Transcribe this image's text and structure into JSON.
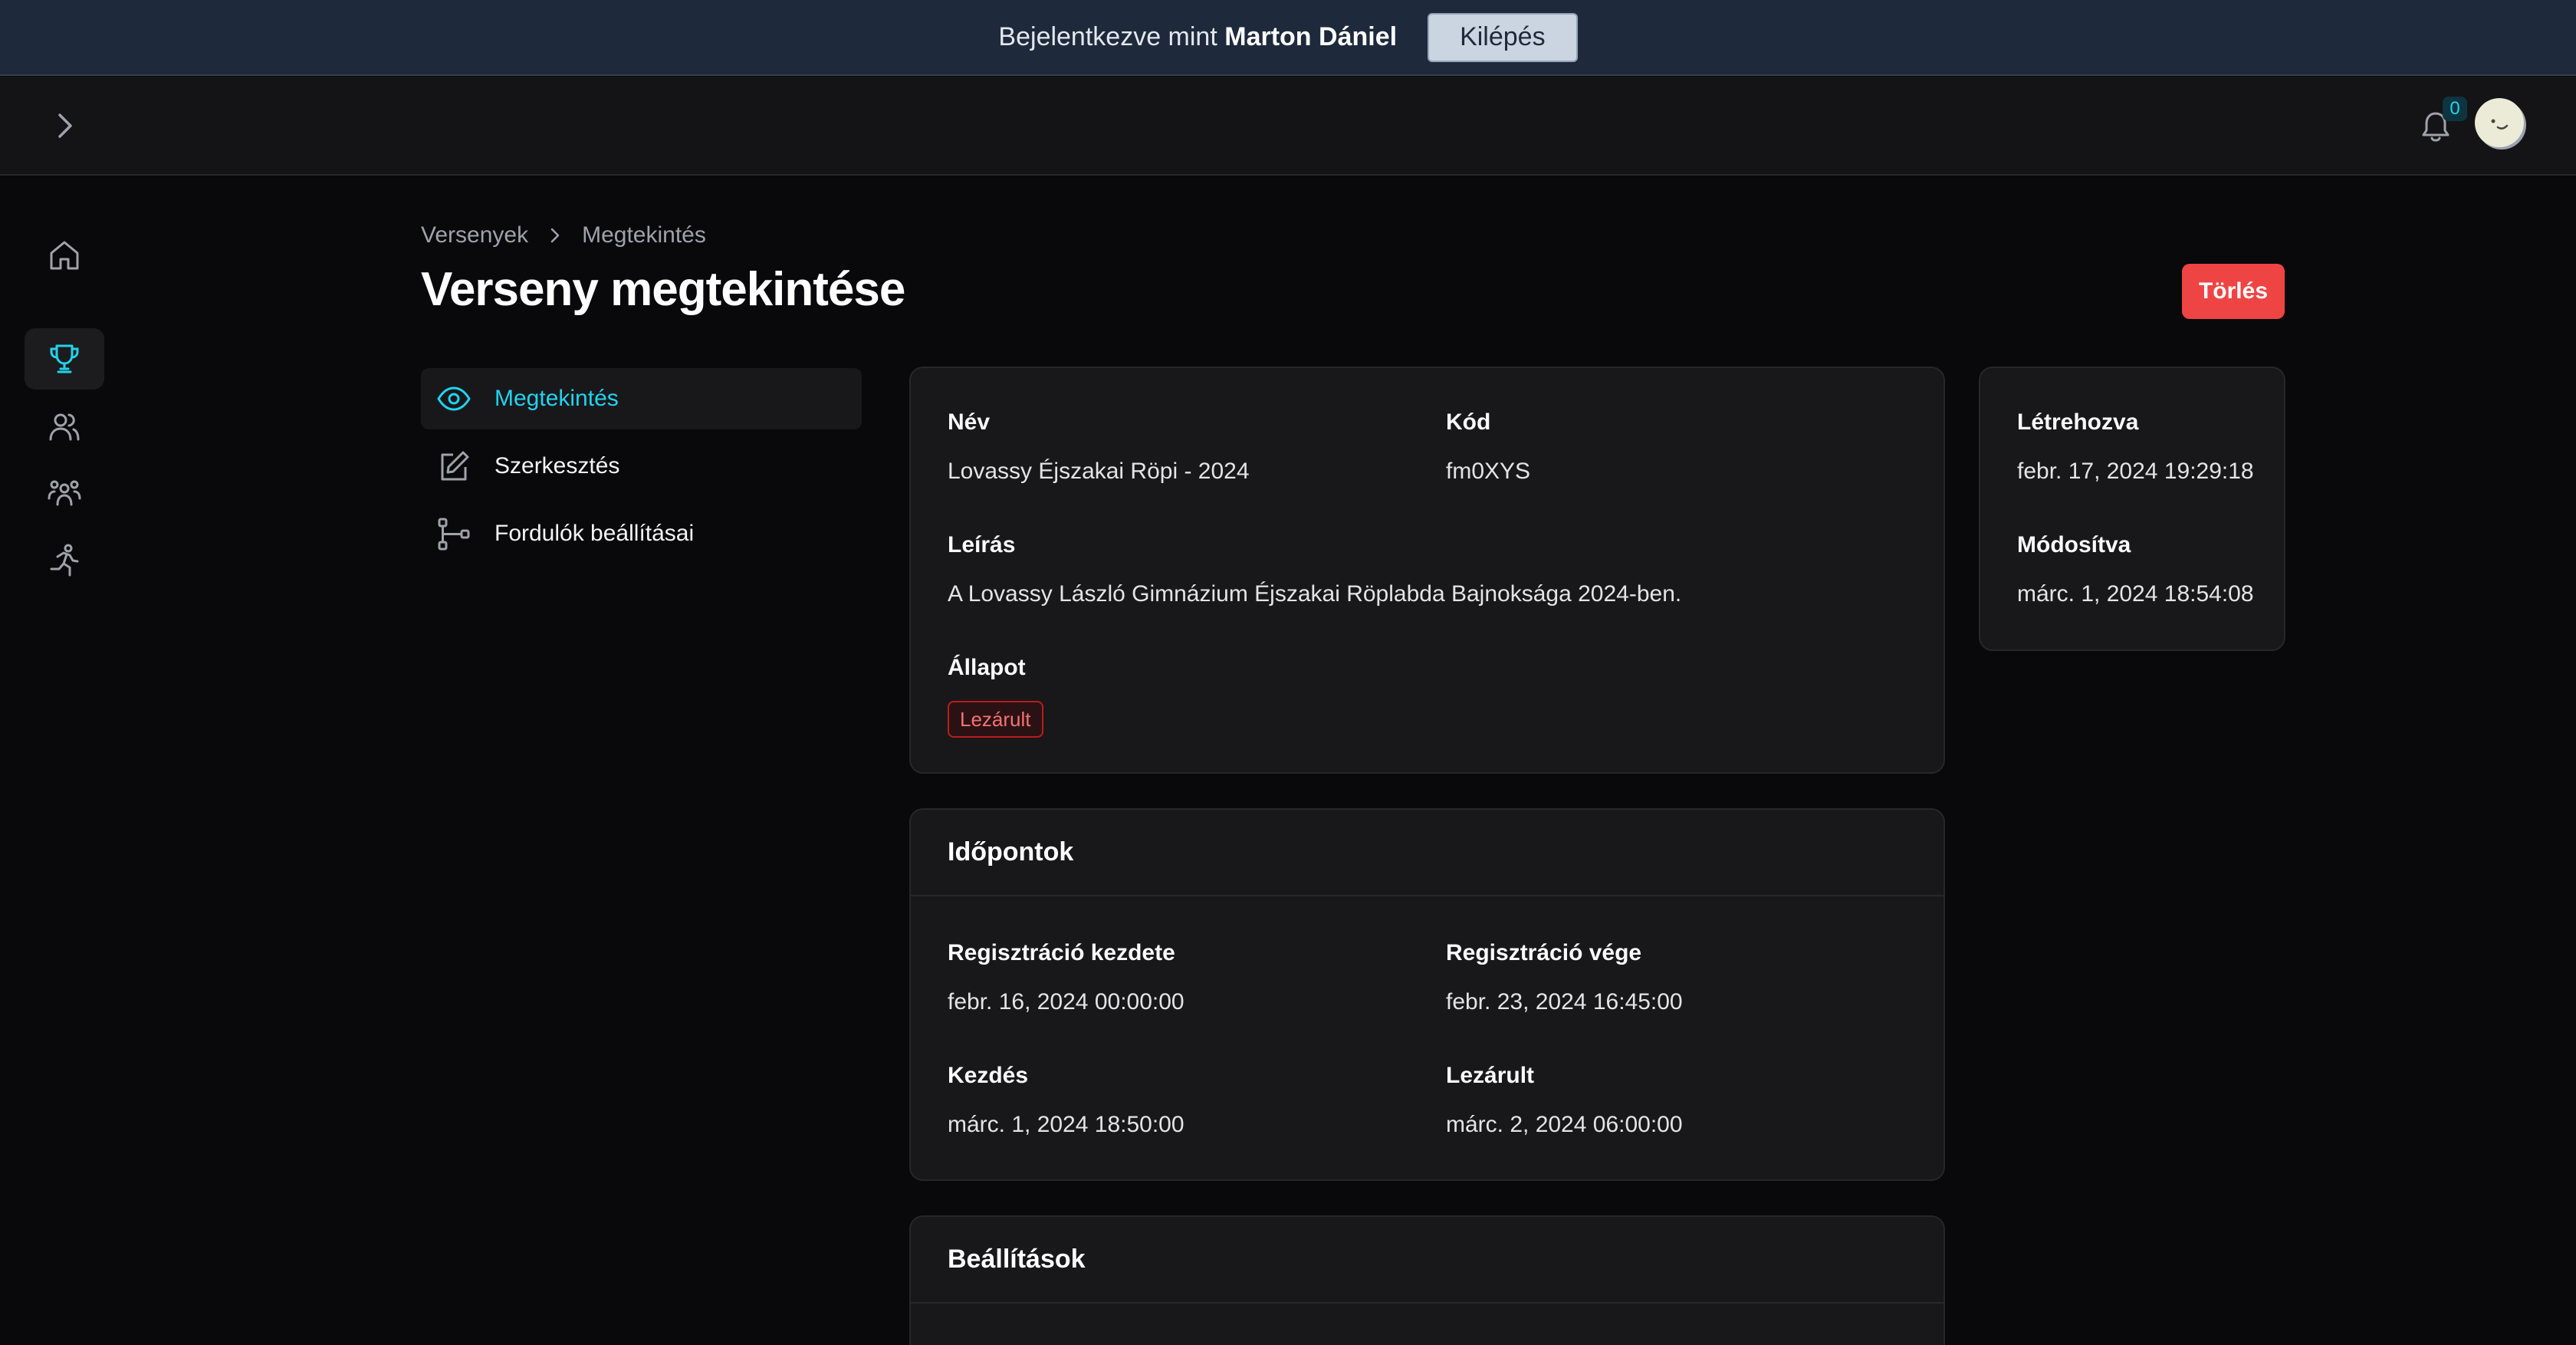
{
  "banner": {
    "prefix": "Bejelentkezve mint",
    "user_name": "Marton Dániel",
    "logout_label": "Kilépés"
  },
  "header": {
    "notification_count": "0"
  },
  "breadcrumb": {
    "items": [
      "Versenyek",
      "Megtekintés"
    ]
  },
  "page": {
    "title": "Verseny megtekintése",
    "delete_label": "Törlés"
  },
  "section_nav": {
    "items": [
      {
        "label": "Megtekintés",
        "icon": "eye-icon",
        "active": true
      },
      {
        "label": "Szerkesztés",
        "icon": "edit-icon",
        "active": false
      },
      {
        "label": "Fordulók beállításai",
        "icon": "workflow-icon",
        "active": false
      }
    ]
  },
  "sidebar": {
    "items": [
      {
        "icon": "home-icon",
        "active": false
      },
      {
        "icon": "trophy-icon",
        "active": true
      },
      {
        "icon": "users-icon",
        "active": false
      },
      {
        "icon": "team-icon",
        "active": false
      },
      {
        "icon": "runner-icon",
        "active": false
      }
    ]
  },
  "details": {
    "name_label": "Név",
    "name_value": "Lovassy Éjszakai Röpi - 2024",
    "code_label": "Kód",
    "code_value": "fm0XYS",
    "description_label": "Leírás",
    "description_value": "A Lovassy László Gimnázium Éjszakai Röplabda Bajnoksága 2024-ben.",
    "status_label": "Állapot",
    "status_value": "Lezárult"
  },
  "meta": {
    "created_label": "Létrehozva",
    "created_value": "febr. 17, 2024 19:29:18",
    "modified_label": "Módosítva",
    "modified_value": "márc. 1, 2024 18:54:08"
  },
  "times": {
    "title": "Időpontok",
    "reg_start_label": "Regisztráció kezdete",
    "reg_start_value": "febr. 16, 2024 00:00:00",
    "reg_end_label": "Regisztráció vége",
    "reg_end_value": "febr. 23, 2024 16:45:00",
    "start_label": "Kezdés",
    "start_value": "márc. 1, 2024 18:50:00",
    "closed_label": "Lezárult",
    "closed_value": "márc. 2, 2024 06:00:00"
  },
  "settings": {
    "title": "Beállítások"
  },
  "colors": {
    "accent": "#22d3ee",
    "danger": "#ef4444",
    "background": "#09090b",
    "card": "#18181b"
  }
}
